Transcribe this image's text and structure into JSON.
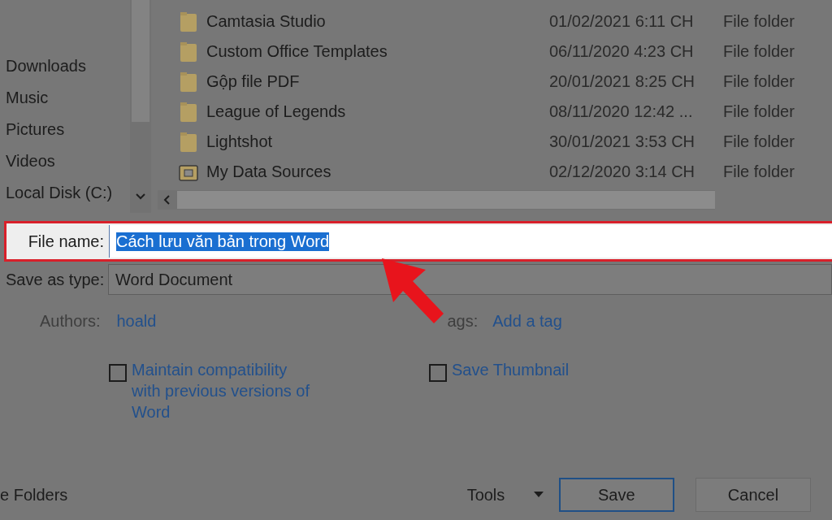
{
  "sidebar": {
    "items": [
      {
        "label": "Downloads"
      },
      {
        "label": "Music"
      },
      {
        "label": "Pictures"
      },
      {
        "label": "Videos"
      },
      {
        "label": "Local Disk (C:)"
      }
    ]
  },
  "files": [
    {
      "name": "Camtasia Studio",
      "date": "01/02/2021 6:11 CH",
      "type": "File folder",
      "kind": "folder"
    },
    {
      "name": "Custom Office Templates",
      "date": "06/11/2020 4:23 CH",
      "type": "File folder",
      "kind": "folder"
    },
    {
      "name": "Gộp file PDF",
      "date": "20/01/2021 8:25 CH",
      "type": "File folder",
      "kind": "folder"
    },
    {
      "name": "League of Legends",
      "date": "08/11/2020 12:42 ...",
      "type": "File folder",
      "kind": "folder"
    },
    {
      "name": "Lightshot",
      "date": "30/01/2021 3:53 CH",
      "type": "File folder",
      "kind": "folder"
    },
    {
      "name": "My Data Sources",
      "date": "02/12/2020 3:14 CH",
      "type": "File folder",
      "kind": "special"
    }
  ],
  "file_name": {
    "label": "File name:",
    "value": "Cách lưu văn bản trong Word",
    "selected": true
  },
  "save_as_type": {
    "label": "Save as type:",
    "value": "Word Document"
  },
  "authors": {
    "label": "Authors:",
    "value": "hoald"
  },
  "tags": {
    "label": "ags:",
    "value": "Add a tag"
  },
  "options": [
    {
      "label": "Maintain compatibility with previous versions of Word",
      "checked": false
    },
    {
      "label": "Save Thumbnail",
      "checked": false
    }
  ],
  "hide_folders": "e Folders",
  "tools": "Tools",
  "buttons": [
    {
      "label": "Save",
      "default": true
    },
    {
      "label": "Cancel",
      "default": false
    }
  ]
}
